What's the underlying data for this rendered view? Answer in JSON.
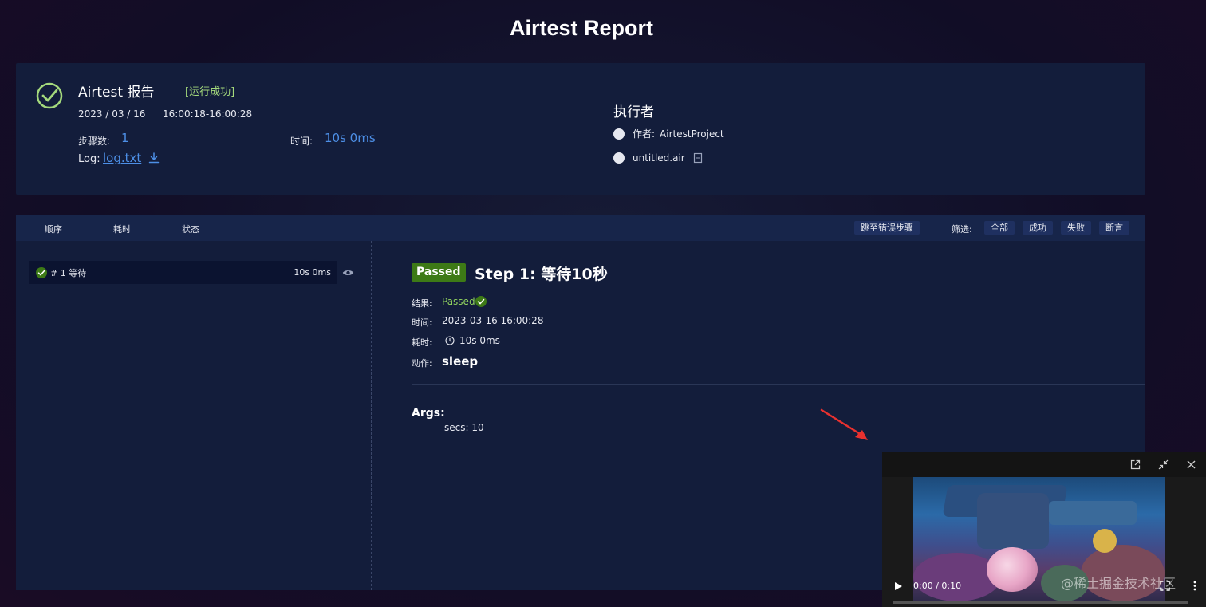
{
  "page": {
    "title": "Airtest Report"
  },
  "summary": {
    "title": "Airtest 报告",
    "status": "[运行成功]",
    "date": "2023 / 03 / 16",
    "time_range": "16:00:18-16:00:28",
    "steps_label": "步骤数:",
    "steps_value": "1",
    "duration_label": "时间:",
    "duration_value": "10s 0ms",
    "log_label": "Log:",
    "log_link": "log.txt",
    "executor_title": "执行者",
    "author_label": "作者:",
    "author_value": "AirtestProject",
    "script_name": "untitled.air"
  },
  "steps_header": {
    "col_order": "顺序",
    "col_duration": "耗时",
    "col_status": "状态",
    "jump_error": "跳至错误步骤",
    "filter_label": "筛选:",
    "filters": [
      "全部",
      "成功",
      "失败",
      "断言"
    ]
  },
  "step_list": [
    {
      "label": "# 1 等待",
      "duration": "10s 0ms"
    }
  ],
  "step_detail": {
    "badge": "Passed",
    "title": "Step 1: 等待10秒",
    "result_label": "结果:",
    "result_value": "Passed",
    "time_label": "时间:",
    "time_value": "2023-03-16 16:00:28",
    "duration_label": "耗时:",
    "duration_value": "10s 0ms",
    "action_label": "动作:",
    "action_value": "sleep",
    "args_title": "Args:",
    "args_value": "secs: 10"
  },
  "player": {
    "time": "0:00 / 0:10",
    "progress": 0.0
  },
  "watermark": "@稀土掘金技术社区",
  "colors": {
    "accent_blue": "#4d8fe6",
    "success_green": "#3d7a16",
    "status_text_green": "#a4d97c"
  }
}
